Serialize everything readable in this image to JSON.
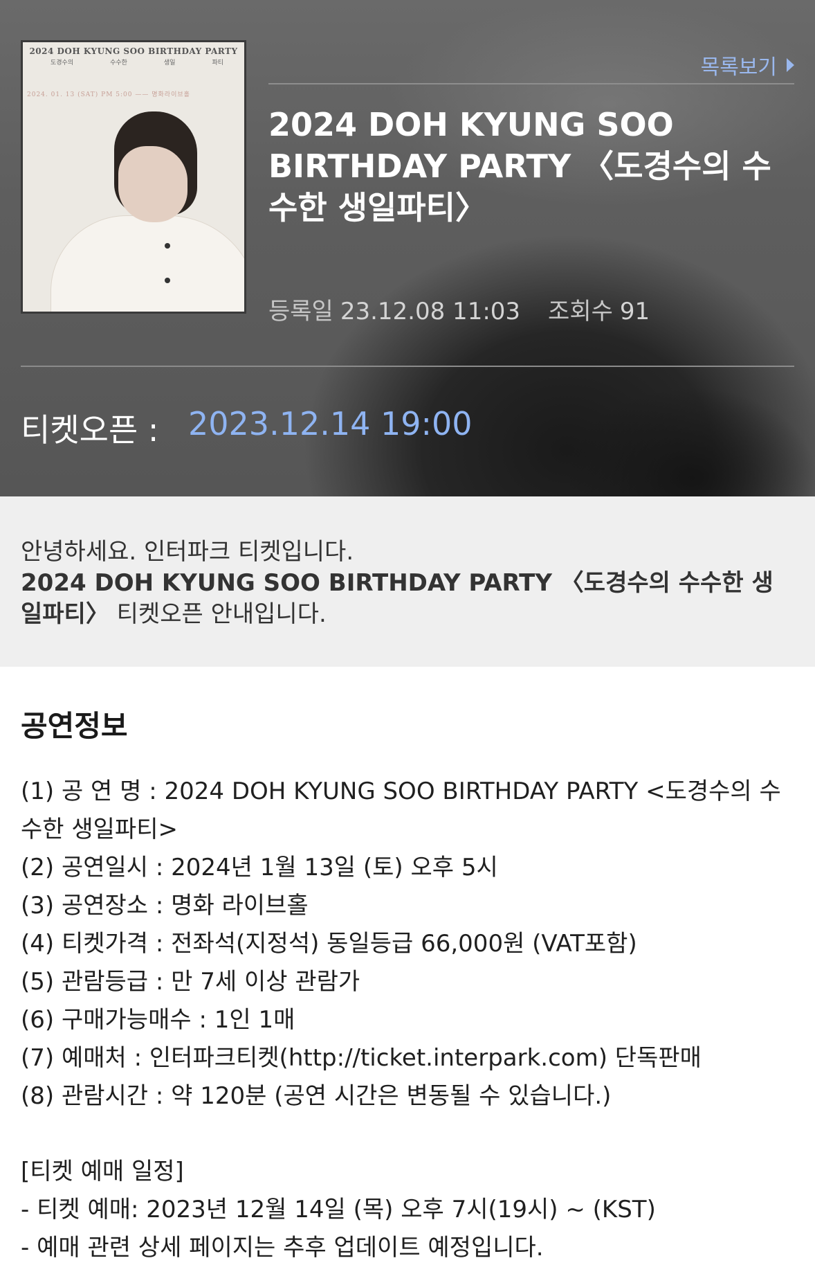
{
  "header": {
    "list_link": "목록보기",
    "title": "2024 DOH KYUNG SOO BIRTHDAY PARTY 〈도경수의 수수한 생일파티〉",
    "registered_label": "등록일",
    "registered_value": "23.12.08 11:03",
    "views_label": "조회수",
    "views_value": "91",
    "ticket_open_label": "티켓오픈 :",
    "ticket_open_value": "2023.12.14 19:00",
    "poster": {
      "title": "2024 DOH KYUNG SOO BIRTHDAY PARTY",
      "sub": [
        "도경수의",
        "수수한",
        "생일",
        "파티"
      ],
      "date": "2024. 01. 13 (SAT) PM 5:00 —— 명화라이브홀"
    }
  },
  "notice": {
    "greeting": "안녕하세요. 인터파크 티켓입니다.",
    "headline": "2024 DOH KYUNG SOO BIRTHDAY PARTY 〈도경수의 수수한 생일파티〉",
    "suffix": " 티켓오픈 안내입니다."
  },
  "info": {
    "section_title": "공연정보",
    "items": [
      "(1) 공 연 명 : 2024 DOH KYUNG SOO BIRTHDAY PARTY <도경수의 수수한 생일파티>",
      "(2) 공연일시 : 2024년 1월 13일 (토) 오후 5시",
      "(3) 공연장소 : 명화 라이브홀",
      "(4) 티켓가격 : 전좌석(지정석) 동일등급 66,000원 (VAT포함)",
      "(5) 관람등급 : 만 7세 이상 관람가",
      "(6) 구매가능매수 : 1인 1매",
      "(7) 예매처 : 인터파크티켓(http://ticket.interpark.com) 단독판매",
      "(8) 관람시간 : 약 120분 (공연 시간은 변동될 수 있습니다.)"
    ],
    "schedule_title": "[티켓 예매 일정]",
    "schedule": [
      "- 티켓 예매: 2023년 12월 14일 (목) 오후 7시(19시) ~ (KST)",
      "- 예매 관련 상세 페이지는 추후 업데이트 예정입니다."
    ]
  },
  "colors": {
    "link": "#9ab8ee",
    "ticket_open_value": "#8fb4f2",
    "notice_bg": "#efefef"
  }
}
